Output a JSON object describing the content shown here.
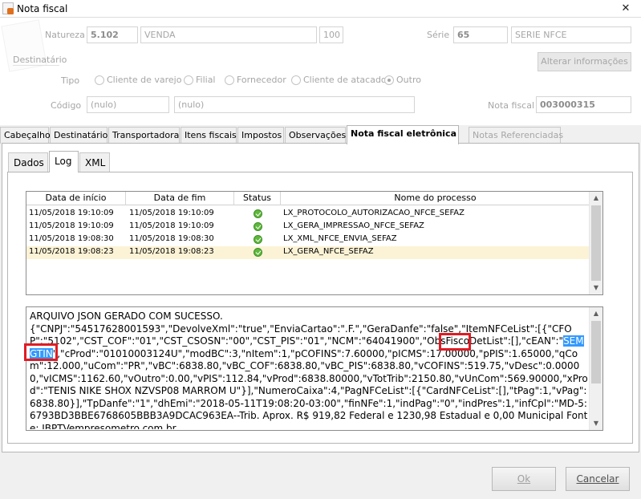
{
  "window": {
    "title": "Nota fiscal",
    "close": "✕"
  },
  "header": {
    "natureza_label": "Natureza",
    "natureza_code": "5.102",
    "natureza_desc": "VENDA",
    "natureza_num": "100",
    "serie_label": "Série",
    "serie_code": "65",
    "serie_desc": "SERIE NFCE",
    "destinatario_label": "Destinatário",
    "alterar_button": "Alterar informações",
    "tipo_label": "Tipo",
    "tipo_options": [
      "Cliente de varejo",
      "Filial",
      "Fornecedor",
      "Cliente de atacado",
      "Outro"
    ],
    "tipo_selected": "Outro",
    "codigo_label": "Código",
    "codigo_value": "(nulo)",
    "codigo_desc": "(nulo)",
    "nota_label": "Nota fiscal",
    "nota_value": "003000315"
  },
  "main_tabs": [
    {
      "label": "Cabeçalho"
    },
    {
      "label": "Destinatário"
    },
    {
      "label": "Transportadora"
    },
    {
      "label": "Itens fiscais"
    },
    {
      "label": "Impostos"
    },
    {
      "label": "Observações"
    },
    {
      "label": "Nota fiscal eletrônica"
    },
    {
      "label": "Notas Referenciadas"
    }
  ],
  "active_main_tab": "Nota fiscal eletrônica",
  "sub_tabs": [
    {
      "label": "Dados"
    },
    {
      "label": "Log"
    },
    {
      "label": "XML"
    }
  ],
  "active_sub_tab": "Log",
  "grid": {
    "columns": [
      "Data de início",
      "Data de fim",
      "Status",
      "Nome do processo"
    ],
    "rows": [
      {
        "start": "11/05/2018 19:10:09",
        "end": "11/05/2018 19:10:09",
        "status": "ok",
        "process": "LX_PROTOCOLO_AUTORIZACAO_NFCE_SEFAZ"
      },
      {
        "start": "11/05/2018 19:10:09",
        "end": "11/05/2018 19:10:09",
        "status": "ok",
        "process": "LX_GERA_IMPRESSAO_NFCE_SEFAZ"
      },
      {
        "start": "11/05/2018 19:08:30",
        "end": "11/05/2018 19:08:30",
        "status": "ok",
        "process": "LX_XML_NFCE_ENVIA_SEFAZ"
      },
      {
        "start": "11/05/2018 19:08:23",
        "end": "11/05/2018 19:08:23",
        "status": "ok",
        "process": "LX_GERA_NFCE_SEFAZ"
      }
    ],
    "selected_row": 3
  },
  "log": {
    "line1": "ARQUIVO JSON GERADO COM SUCESSO.",
    "part1": "{\"CNPJ\":\"54517628001593\",\"DevolveXml\":\"true\",\"EnviaCartao\":\".F.\",\"GeraDanfe\":\"false\",\"ItemNFCeList\":[{\"CFOP\":\"5102\",\"CST_COF\":\"01\",\"CST_CSOSN\":\"00\",\"CST_PIS\":\"01\",\"NCM\":\"64041900\",\"ObsFiscoDetList\":[],\"cEAN\":\"",
    "hl1": "SEM",
    "hl2": "GTIN",
    "part2": "\",\"cProd\":\"01010003124U\",\"modBC\":3,\"nItem\":1,\"pCOFINS\":7.60000,\"pICMS\":17.00000,\"pPIS\":1.65000,\"qCom\":12.000,\"uCom\":\"PR\",\"vBC\":6838.80,\"vBC_COF\":6838.80,\"vBC_PIS\":6838.80,\"vCOFINS\":519.75,\"vDesc\":0.00000,\"vICMS\":1162.60,\"vOutro\":0.00,\"vPIS\":112.84,\"vProd\":6838.80000,\"vTotTrib\":2150.80,\"vUnCom\":569.90000,\"xProd\":\"TENIS NIKE SHOX NZVSP08 MARROM U\"}],\"NumeroCaixa\":4,\"PagNFCeList\":[{\"CardNFCeList\":[],\"tPag\":1,\"vPag\":6838.80}],\"TpDanfe\":\"1\",\"dhEmi\":\"2018-05-11T19:08:20-03:00\",\"finNFe\":1,\"indPag\":\"0\",\"indPres\":1,\"infCpl\":\"MD-5:6793BD3BBE6768605BBB3A9DCAC963EA--Trib. Aprox. R$ 919,82 Federal e 1230,98 Estadual e 0,00 Municipal Fonte: IBPTVempresometro.com.br"
  },
  "footer": {
    "ok": "Ok",
    "cancel": "Cancelar"
  },
  "colors": {
    "highlight": "#3399ff",
    "annotation_red": "#e01b24",
    "row_selected": "#fcf3d6"
  }
}
